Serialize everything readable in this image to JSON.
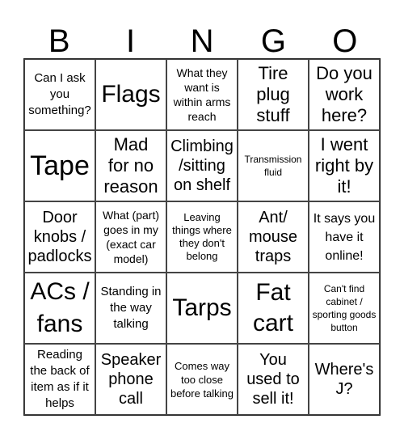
{
  "header": {
    "letters": [
      "B",
      "I",
      "N",
      "G",
      "O"
    ]
  },
  "cells": [
    "Can I ask you something?",
    "Flags",
    "What they want is within arms reach",
    "Tire plug stuff",
    "Do you work here?",
    "Tape",
    "Mad for no reason",
    "Climbing /sitting on shelf",
    "Transmission fluid",
    "I went right by it!",
    "Door knobs / padlocks",
    "What (part) goes in my (exact car model)",
    "Leaving things where they don't belong",
    "Ant/ mouse traps",
    "It says you have it online!",
    "ACs / fans",
    "Standing in the way talking",
    "Tarps",
    "Fat cart",
    "Can't find cabinet / sporting goods button",
    "Reading the back of item as if it helps",
    "Speaker phone call",
    "Comes way too close before talking",
    "You used to sell it!",
    "Where's J?"
  ]
}
